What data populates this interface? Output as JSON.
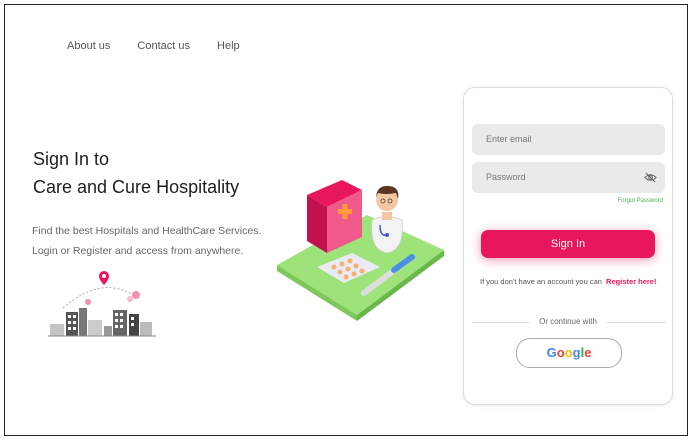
{
  "nav": {
    "items": [
      "About us",
      "Contact us",
      "Help"
    ]
  },
  "hero": {
    "title_line1": "Sign In to",
    "title_line2": "Care and Cure Hospitality",
    "desc_line1": "Find the best Hospitals and HealthCare Services.",
    "desc_line2": "Login or Register and access from anywhere."
  },
  "form": {
    "email_placeholder": "Enter email",
    "password_placeholder": "Password",
    "forgot": "Forgot Password",
    "signin_label": "Sign In",
    "register_text": "If you don't have an account you can",
    "register_link": "Register here!",
    "or_continue": "Or continue with",
    "google_label": "Google"
  },
  "colors": {
    "accent": "#e8175d",
    "field_bg": "#eaeaea",
    "link_green": "#4caf50"
  },
  "icons": {
    "password_toggle": "eye-off-icon",
    "location": "location-pin-icon"
  }
}
